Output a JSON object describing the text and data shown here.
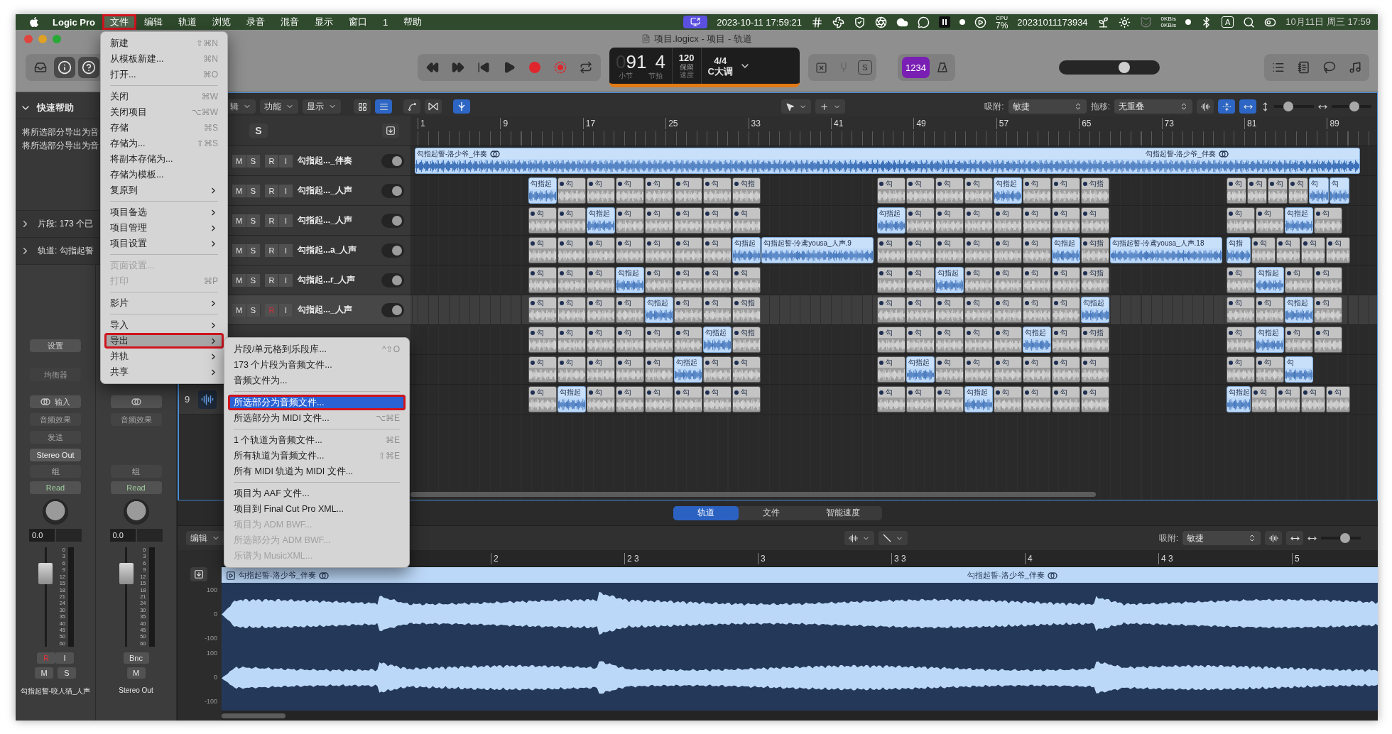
{
  "menubar": {
    "app": "Logic Pro",
    "items": [
      {
        "label": "文件",
        "selected": true,
        "annotated": true
      },
      {
        "label": "编辑",
        "selected": false,
        "annotated": false
      },
      {
        "label": "轨道",
        "selected": false,
        "annotated": false
      },
      {
        "label": "浏览",
        "selected": false,
        "annotated": false
      },
      {
        "label": "录音",
        "selected": false,
        "annotated": false
      },
      {
        "label": "混音",
        "selected": false,
        "annotated": false
      },
      {
        "label": "显示",
        "selected": false,
        "annotated": false
      },
      {
        "label": "窗口",
        "selected": false,
        "annotated": false
      },
      {
        "label": "1",
        "selected": false,
        "annotated": false
      },
      {
        "label": "帮助",
        "selected": false,
        "annotated": false
      }
    ],
    "status": {
      "datetime": "2023-10-11 17:59:21",
      "cpu_label": "CPU",
      "cpu": "7%",
      "stamp": "20231011173934",
      "net_up": "0KB/s",
      "net_down": "0KB/s",
      "input_source": "A",
      "clock": "10月11日 周三 17:59"
    }
  },
  "window": {
    "title": "项目.logicx - 项目 - 轨道"
  },
  "lcd": {
    "bar_dim": "0",
    "bar": "91",
    "beat": "4",
    "bar_label": "小节",
    "beat_label": "节拍",
    "tempo": "120",
    "tempo_mode": "保留",
    "tempo_label": "速度",
    "signature": "4/4",
    "key": "C大调",
    "solo_label": "S",
    "count_in": "1234"
  },
  "master_volume": {
    "level": 0.66
  },
  "inspector": {
    "quick_help": {
      "title": "快速帮助",
      "expanded": true,
      "lines": [
        "将所选部分导出为音",
        "将所选部分导出为音"
      ]
    },
    "sections": [
      {
        "label": "片段:",
        "value": "173 个已",
        "expanded": false
      },
      {
        "label": "轨道:",
        "value": "勾指起誓",
        "expanded": false
      }
    ]
  },
  "strips": [
    {
      "kind": "track",
      "setting": "设置",
      "eq": "均衡器",
      "input": "输入",
      "fx": "音频效果",
      "send": "发送",
      "output": "Stereo Out",
      "group": "组",
      "automation": "Read",
      "pan_value": "0.0",
      "fader": {
        "level": 0.8
      },
      "scale": [
        "0",
        "3",
        "6",
        "9",
        "12",
        "15",
        "18",
        "21",
        "24",
        "30",
        "35",
        "40",
        "45",
        "50",
        "60"
      ],
      "record": "R",
      "record_armed": true,
      "monitor": "I",
      "mute": "M",
      "solo": "S",
      "name": "勾指起誓-咬人猫_人声"
    },
    {
      "kind": "output",
      "fx": "音频效果",
      "group": "组",
      "automation": "Read",
      "pan_value": "0.0",
      "fader": {
        "level": 0.8
      },
      "scale": [
        "0",
        "3",
        "6",
        "9",
        "12",
        "15",
        "18",
        "21",
        "24",
        "30",
        "35",
        "40",
        "45",
        "50",
        "60"
      ],
      "bounce": "Bnc",
      "mute": "M",
      "name": "Stereo Out"
    }
  ],
  "tracks_toolbar": {
    "menus": [
      "辑",
      "功能",
      "显示"
    ],
    "solo": "S",
    "snap_label": "吸附:",
    "snap": "敏捷",
    "drag_label": "拖移:",
    "drag": "无重叠",
    "vertical_zoom": {
      "level": 0.3
    },
    "horizontal_zoom": {
      "level": 0.6
    }
  },
  "ruler": [
    "1",
    "9",
    "17",
    "25",
    "33",
    "41",
    "49",
    "57",
    "65",
    "73",
    "81",
    "89"
  ],
  "tracks": [
    {
      "kind": "full",
      "selected": false,
      "header": {
        "kind": "full",
        "buttons": [
          "M",
          "S",
          "R",
          "I"
        ],
        "name": "勾指起..._伴奏",
        "record_armed": false
      },
      "region": {
        "label": "勾指起誓-洛少爷_伴奏",
        "end_label": "勾指起誓-洛少爷_伴奏",
        "selected": true
      }
    },
    {
      "kind": "clips",
      "selected": false,
      "header": {
        "kind": "full",
        "buttons": [
          "M",
          "S",
          "R",
          "I"
        ],
        "name": "勾指起..._人声",
        "record_armed": false
      },
      "blocks": [
        [
          {
            "label": "勾指起",
            "selected": true
          },
          {
            "label": "勾",
            "selected": false
          },
          {
            "label": "勾",
            "selected": false
          },
          {
            "label": "勾",
            "selected": false
          },
          {
            "label": "勾",
            "selected": false
          },
          {
            "label": "勾",
            "selected": false
          },
          {
            "label": "勾",
            "selected": false
          },
          {
            "label": "勾指",
            "selected": false
          }
        ],
        [
          {
            "label": "勾",
            "selected": false
          },
          {
            "label": "勾",
            "selected": false
          },
          {
            "label": "勾",
            "selected": false
          },
          {
            "label": "勾",
            "selected": false
          },
          {
            "label": "勾指起",
            "selected": true
          },
          {
            "label": "勾",
            "selected": false
          },
          {
            "label": "勾",
            "selected": false
          },
          {
            "label": "勾指",
            "selected": false
          }
        ],
        [
          {
            "label": "勾",
            "selected": false
          },
          {
            "label": "勾",
            "selected": false
          },
          {
            "label": "勾",
            "selected": false
          },
          {
            "label": "勾",
            "selected": false
          },
          {
            "label": "勾",
            "selected": true
          },
          {
            "label": "勾",
            "selected": true
          }
        ]
      ]
    },
    {
      "kind": "clips",
      "selected": false,
      "header": {
        "kind": "full",
        "buttons": [
          "M",
          "S",
          "R",
          "I"
        ],
        "name": "勾指起..._人声",
        "record_armed": false
      },
      "blocks": [
        [
          {
            "label": "勾",
            "selected": false
          },
          {
            "label": "勾",
            "selected": false
          },
          {
            "label": "勾指起",
            "selected": true
          },
          {
            "label": "勾",
            "selected": false
          },
          {
            "label": "勾",
            "selected": false
          },
          {
            "label": "勾",
            "selected": false
          },
          {
            "label": "勾",
            "selected": false
          },
          {
            "label": "勾",
            "selected": false
          }
        ],
        [
          {
            "label": "勾指起",
            "selected": true
          },
          {
            "label": "勾",
            "selected": false
          },
          {
            "label": "勾",
            "selected": false
          },
          {
            "label": "勾",
            "selected": false
          },
          {
            "label": "勾",
            "selected": false
          },
          {
            "label": "勾",
            "selected": false
          },
          {
            "label": "勾",
            "selected": false
          },
          {
            "label": "勾",
            "selected": false
          }
        ],
        [
          {
            "label": "勾",
            "selected": false
          },
          {
            "label": "勾",
            "selected": false
          },
          {
            "label": "勾指起",
            "selected": true
          },
          {
            "label": "勾",
            "selected": false
          }
        ]
      ]
    },
    {
      "kind": "clips",
      "selected": false,
      "header": {
        "kind": "full",
        "buttons": [
          "M",
          "S",
          "R",
          "I"
        ],
        "name": "勾指起...a_人声",
        "record_armed": false
      },
      "blocks": [
        [
          {
            "label": "勾",
            "selected": false
          },
          {
            "label": "勾",
            "selected": false
          },
          {
            "label": "勾",
            "selected": false
          },
          {
            "label": "勾",
            "selected": false
          },
          {
            "label": "勾",
            "selected": false
          },
          {
            "label": "勾",
            "selected": false
          },
          {
            "label": "勾",
            "selected": false
          },
          {
            "label": "勾指起",
            "selected": true
          },
          {
            "label": "勾指起誓-泠鸢yousa_人声.9",
            "selected": true,
            "kind": "long"
          }
        ],
        [
          {
            "label": "勾",
            "selected": false
          },
          {
            "label": "勾",
            "selected": false
          },
          {
            "label": "勾",
            "selected": false
          },
          {
            "label": "勾",
            "selected": false
          },
          {
            "label": "勾",
            "selected": false
          },
          {
            "label": "勾",
            "selected": false
          },
          {
            "label": "勾指起",
            "selected": true
          },
          {
            "label": "勾指",
            "selected": false
          },
          {
            "label": "勾指起誓-泠鸢yousa_人声.18",
            "selected": true,
            "kind": "long"
          }
        ],
        [
          {
            "label": "勾指",
            "selected": true
          },
          {
            "label": "勾",
            "selected": false
          },
          {
            "label": "勾",
            "selected": false
          },
          {
            "label": "勾",
            "selected": false
          },
          {
            "label": "勾",
            "selected": false
          }
        ]
      ]
    },
    {
      "kind": "clips",
      "selected": false,
      "header": {
        "kind": "full",
        "buttons": [
          "M",
          "S",
          "R",
          "I"
        ],
        "name": "勾指起...r_人声",
        "record_armed": false
      },
      "blocks": [
        [
          {
            "label": "勾",
            "selected": false
          },
          {
            "label": "勾",
            "selected": false
          },
          {
            "label": "勾",
            "selected": false
          },
          {
            "label": "勾指起",
            "selected": true
          },
          {
            "label": "勾",
            "selected": false
          },
          {
            "label": "勾",
            "selected": false
          },
          {
            "label": "勾",
            "selected": false
          },
          {
            "label": "勾",
            "selected": false
          }
        ],
        [
          {
            "label": "勾",
            "selected": false
          },
          {
            "label": "勾",
            "selected": false
          },
          {
            "label": "勾指起",
            "selected": true
          },
          {
            "label": "勾",
            "selected": false
          },
          {
            "label": "勾",
            "selected": false
          },
          {
            "label": "勾",
            "selected": false
          },
          {
            "label": "勾",
            "selected": false
          },
          {
            "label": "勾指",
            "selected": false
          }
        ],
        [
          {
            "label": "勾",
            "selected": false
          },
          {
            "label": "勾指起",
            "selected": true
          },
          {
            "label": "勾",
            "selected": false
          },
          {
            "label": "勾",
            "selected": false
          }
        ]
      ]
    },
    {
      "kind": "clips",
      "selected": true,
      "header": {
        "kind": "full",
        "buttons": [
          "M",
          "S",
          "R",
          "I"
        ],
        "name": "勾指起..._人声",
        "record_armed": true
      },
      "blocks": [
        [
          {
            "label": "勾",
            "selected": false
          },
          {
            "label": "勾",
            "selected": false
          },
          {
            "label": "勾",
            "selected": false
          },
          {
            "label": "勾",
            "selected": false
          },
          {
            "label": "勾指起",
            "selected": true
          },
          {
            "label": "勾",
            "selected": false
          },
          {
            "label": "勾",
            "selected": false
          },
          {
            "label": "勾指",
            "selected": false
          }
        ],
        [
          {
            "label": "勾",
            "selected": false
          },
          {
            "label": "勾",
            "selected": false
          },
          {
            "label": "勾",
            "selected": false
          },
          {
            "label": "勾",
            "selected": false
          },
          {
            "label": "勾",
            "selected": false
          },
          {
            "label": "勾",
            "selected": false
          },
          {
            "label": "勾",
            "selected": false
          },
          {
            "label": "勾指起",
            "selected": true
          }
        ],
        [
          {
            "label": "勾",
            "selected": false
          },
          {
            "label": "勾",
            "selected": false
          },
          {
            "label": "勾指起",
            "selected": true
          },
          {
            "label": "勾",
            "selected": false
          }
        ]
      ]
    },
    {
      "kind": "clips",
      "selected": false,
      "blocks": [
        [
          {
            "label": "勾",
            "selected": false
          },
          {
            "label": "勾",
            "selected": false
          },
          {
            "label": "勾",
            "selected": false
          },
          {
            "label": "勾",
            "selected": false
          },
          {
            "label": "勾",
            "selected": false
          },
          {
            "label": "勾",
            "selected": false
          },
          {
            "label": "勾指起",
            "selected": true
          },
          {
            "label": "勾指",
            "selected": false
          }
        ],
        [
          {
            "label": "勾",
            "selected": false
          },
          {
            "label": "勾",
            "selected": false
          },
          {
            "label": "勾",
            "selected": false
          },
          {
            "label": "勾",
            "selected": false
          },
          {
            "label": "勾",
            "selected": false
          },
          {
            "label": "勾指起",
            "selected": true
          },
          {
            "label": "勾",
            "selected": false
          },
          {
            "label": "勾指",
            "selected": false
          }
        ],
        [
          {
            "label": "勾",
            "selected": false
          },
          {
            "label": "勾指起",
            "selected": true
          },
          {
            "label": "勾",
            "selected": false
          },
          {
            "label": "勾",
            "selected": false
          }
        ]
      ]
    },
    {
      "kind": "clips",
      "selected": false,
      "blocks": [
        [
          {
            "label": "勾",
            "selected": false
          },
          {
            "label": "勾",
            "selected": false
          },
          {
            "label": "勾",
            "selected": false
          },
          {
            "label": "勾",
            "selected": false
          },
          {
            "label": "勾",
            "selected": false
          },
          {
            "label": "勾指起",
            "selected": true
          },
          {
            "label": "勾",
            "selected": false
          },
          {
            "label": "勾",
            "selected": false
          }
        ],
        [
          {
            "label": "勾",
            "selected": false
          },
          {
            "label": "勾指起",
            "selected": true
          },
          {
            "label": "勾",
            "selected": false
          },
          {
            "label": "勾",
            "selected": false
          },
          {
            "label": "勾",
            "selected": false
          },
          {
            "label": "勾",
            "selected": false
          },
          {
            "label": "勾",
            "selected": false
          },
          {
            "label": "勾",
            "selected": false
          }
        ],
        [
          {
            "label": "勾",
            "selected": false
          },
          {
            "label": "勾",
            "selected": false
          },
          {
            "label": "勾",
            "selected": true
          }
        ]
      ]
    },
    {
      "kind": "clips",
      "selected": false,
      "header": {
        "kind": "number",
        "number": "9"
      },
      "blocks": [
        [
          {
            "label": "勾",
            "selected": false
          },
          {
            "label": "勾指起",
            "selected": true
          },
          {
            "label": "勾",
            "selected": false
          },
          {
            "label": "勾",
            "selected": false
          },
          {
            "label": "勾",
            "selected": false
          },
          {
            "label": "勾",
            "selected": false
          },
          {
            "label": "勾",
            "selected": false
          },
          {
            "label": "勾",
            "selected": false
          }
        ],
        [
          {
            "label": "勾",
            "selected": false
          },
          {
            "label": "勾",
            "selected": false
          },
          {
            "label": "勾",
            "selected": false
          },
          {
            "label": "勾指起",
            "selected": true
          },
          {
            "label": "勾",
            "selected": false
          },
          {
            "label": "勾",
            "selected": false
          },
          {
            "label": "勾",
            "selected": false
          },
          {
            "label": "勾",
            "selected": false
          }
        ],
        [
          {
            "label": "勾指起",
            "selected": true
          },
          {
            "label": "勾",
            "selected": false
          },
          {
            "label": "勾",
            "selected": false
          },
          {
            "label": "勾",
            "selected": false
          },
          {
            "label": "勾",
            "selected": false
          }
        ]
      ]
    }
  ],
  "editor": {
    "tabs": [
      {
        "label": "轨道",
        "selected": true
      },
      {
        "label": "文件",
        "selected": false
      },
      {
        "label": "智能速度",
        "selected": false
      }
    ],
    "menu": "编辑",
    "snap_label": "吸附:",
    "snap": "敏捷",
    "zoom": {
      "level": 0.65
    },
    "ruler": [
      "2",
      "2 3",
      "3",
      "3 3",
      "4",
      "4 3",
      "5"
    ],
    "region_labels": [
      "勾指起誓-洛少爷_伴奏",
      "勾指起誓-洛少爷_伴奏"
    ],
    "amplitude": [
      "100",
      "0",
      "-100",
      "100",
      "0",
      "-100"
    ]
  },
  "file_menu": {
    "items": [
      {
        "kind": "item",
        "label": "新建",
        "shortcut": "⇧⌘N",
        "submenu": false,
        "selected": false,
        "disabled": false,
        "annotated": false
      },
      {
        "kind": "item",
        "label": "从模板新建...",
        "shortcut": "⌘N",
        "submenu": false,
        "selected": false,
        "disabled": false,
        "annotated": false
      },
      {
        "kind": "item",
        "label": "打开...",
        "shortcut": "⌘O",
        "submenu": false,
        "selected": false,
        "disabled": false,
        "annotated": false
      },
      {
        "kind": "separator"
      },
      {
        "kind": "item",
        "label": "关闭",
        "shortcut": "⌘W",
        "submenu": false,
        "selected": false,
        "disabled": false,
        "annotated": false
      },
      {
        "kind": "item",
        "label": "关闭项目",
        "shortcut": "⌥⌘W",
        "submenu": false,
        "selected": false,
        "disabled": false,
        "annotated": false
      },
      {
        "kind": "item",
        "label": "存储",
        "shortcut": "⌘S",
        "submenu": false,
        "selected": false,
        "disabled": false,
        "annotated": false
      },
      {
        "kind": "item",
        "label": "存储为...",
        "shortcut": "⇧⌘S",
        "submenu": false,
        "selected": false,
        "disabled": false,
        "annotated": false
      },
      {
        "kind": "item",
        "label": "将副本存储为...",
        "submenu": false,
        "selected": false,
        "disabled": false,
        "annotated": false
      },
      {
        "kind": "item",
        "label": "存储为模板...",
        "submenu": false,
        "selected": false,
        "disabled": false,
        "annotated": false
      },
      {
        "kind": "item",
        "label": "复原到",
        "submenu": true,
        "selected": false,
        "disabled": false,
        "annotated": false
      },
      {
        "kind": "separator"
      },
      {
        "kind": "item",
        "label": "项目备选",
        "submenu": true,
        "selected": false,
        "disabled": false,
        "annotated": false
      },
      {
        "kind": "item",
        "label": "项目管理",
        "submenu": true,
        "selected": false,
        "disabled": false,
        "annotated": false
      },
      {
        "kind": "item",
        "label": "项目设置",
        "submenu": true,
        "selected": false,
        "disabled": false,
        "annotated": false
      },
      {
        "kind": "separator"
      },
      {
        "kind": "item",
        "label": "页面设置...",
        "submenu": false,
        "selected": false,
        "disabled": true,
        "annotated": false
      },
      {
        "kind": "item",
        "label": "打印",
        "shortcut": "⌘P",
        "submenu": false,
        "selected": false,
        "disabled": true,
        "annotated": false
      },
      {
        "kind": "separator"
      },
      {
        "kind": "item",
        "label": "影片",
        "submenu": true,
        "selected": false,
        "disabled": false,
        "annotated": false
      },
      {
        "kind": "separator"
      },
      {
        "kind": "item",
        "label": "导入",
        "submenu": true,
        "selected": false,
        "disabled": false,
        "annotated": false
      },
      {
        "kind": "item",
        "label": "导出",
        "submenu": true,
        "selected": true,
        "disabled": false,
        "annotated": true
      },
      {
        "kind": "item",
        "label": "并轨",
        "submenu": true,
        "selected": false,
        "disabled": false,
        "annotated": false
      },
      {
        "kind": "item",
        "label": "共享",
        "submenu": true,
        "selected": false,
        "disabled": false,
        "annotated": false
      }
    ]
  },
  "export_menu": {
    "items": [
      {
        "kind": "item",
        "label": "片段/单元格到乐段库...",
        "shortcut": "^⇧O",
        "submenu": false,
        "selected": false,
        "disabled": false,
        "annotated": false
      },
      {
        "kind": "item",
        "label": "173 个片段为音频文件...",
        "submenu": false,
        "selected": false,
        "disabled": false,
        "annotated": false
      },
      {
        "kind": "item",
        "label": "音频文件为...",
        "submenu": false,
        "selected": false,
        "disabled": false,
        "annotated": false
      },
      {
        "kind": "separator"
      },
      {
        "kind": "item",
        "label": "所选部分为音频文件...",
        "submenu": false,
        "selected": true,
        "disabled": false,
        "annotated": true
      },
      {
        "kind": "item",
        "label": "所选部分为 MIDI 文件...",
        "shortcut": "⌥⌘E",
        "submenu": false,
        "selected": false,
        "disabled": false,
        "annotated": false
      },
      {
        "kind": "separator"
      },
      {
        "kind": "item",
        "label": "1 个轨道为音频文件...",
        "shortcut": "⌘E",
        "submenu": false,
        "selected": false,
        "disabled": false,
        "annotated": false
      },
      {
        "kind": "item",
        "label": "所有轨道为音频文件...",
        "shortcut": "⇧⌘E",
        "submenu": false,
        "selected": false,
        "disabled": false,
        "annotated": false
      },
      {
        "kind": "item",
        "label": "所有 MIDI 轨道为 MIDI 文件...",
        "submenu": false,
        "selected": false,
        "disabled": false,
        "annotated": false
      },
      {
        "kind": "separator"
      },
      {
        "kind": "item",
        "label": "项目为 AAF 文件...",
        "submenu": false,
        "selected": false,
        "disabled": false,
        "annotated": false
      },
      {
        "kind": "item",
        "label": "项目到 Final Cut Pro XML...",
        "submenu": false,
        "selected": false,
        "disabled": false,
        "annotated": false
      },
      {
        "kind": "item",
        "label": "项目为 ADM BWF...",
        "submenu": false,
        "selected": false,
        "disabled": true,
        "annotated": false
      },
      {
        "kind": "item",
        "label": "所选部分为 ADM BWF...",
        "submenu": false,
        "selected": false,
        "disabled": true,
        "annotated": false
      },
      {
        "kind": "item",
        "label": "乐谱为 MusicXML...",
        "submenu": false,
        "selected": false,
        "disabled": true,
        "annotated": false
      }
    ]
  }
}
